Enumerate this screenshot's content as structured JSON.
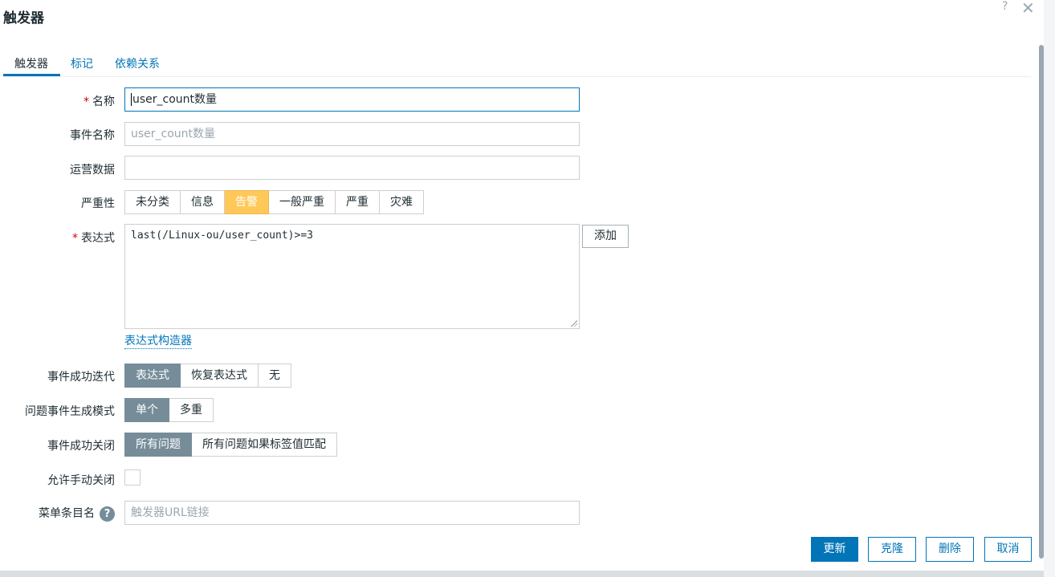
{
  "dialog": {
    "title": "触发器",
    "help": "?",
    "close": "✕"
  },
  "tabs": [
    {
      "label": "触发器"
    },
    {
      "label": "标记"
    },
    {
      "label": "依赖关系"
    }
  ],
  "form": {
    "name": {
      "label": "名称",
      "required": "*",
      "value": "user_count数量"
    },
    "event_name": {
      "label": "事件名称",
      "placeholder": "user_count数量"
    },
    "opdata": {
      "label": "运营数据",
      "value": ""
    },
    "severity": {
      "label": "严重性",
      "options": [
        "未分类",
        "信息",
        "告警",
        "一般严重",
        "严重",
        "灾难"
      ],
      "selected": "告警"
    },
    "expression": {
      "label": "表达式",
      "required": "*",
      "value": "last(/Linux-ou/user_count)>=3",
      "add_button": "添加",
      "constructor_link": "表达式构造器"
    },
    "ok_event": {
      "label": "事件成功迭代",
      "options": [
        "表达式",
        "恢复表达式",
        "无"
      ],
      "selected": "表达式"
    },
    "problem_mode": {
      "label": "问题事件生成模式",
      "options": [
        "单个",
        "多重"
      ],
      "selected": "单个"
    },
    "ok_close": {
      "label": "事件成功关闭",
      "options": [
        "所有问题",
        "所有问题如果标签值匹配"
      ],
      "selected": "所有问题"
    },
    "manual_close": {
      "label": "允许手动关闭",
      "checked": false
    },
    "url_name": {
      "label": "菜单条目名",
      "help_glyph": "?",
      "placeholder": "触发器URL链接"
    }
  },
  "footer": {
    "update": "更新",
    "clone": "克隆",
    "delete": "删除",
    "cancel": "取消"
  },
  "colors": {
    "accent": "#0275b8",
    "selected": "#768d99",
    "warning": "#ffc859",
    "required": "#d40000"
  }
}
